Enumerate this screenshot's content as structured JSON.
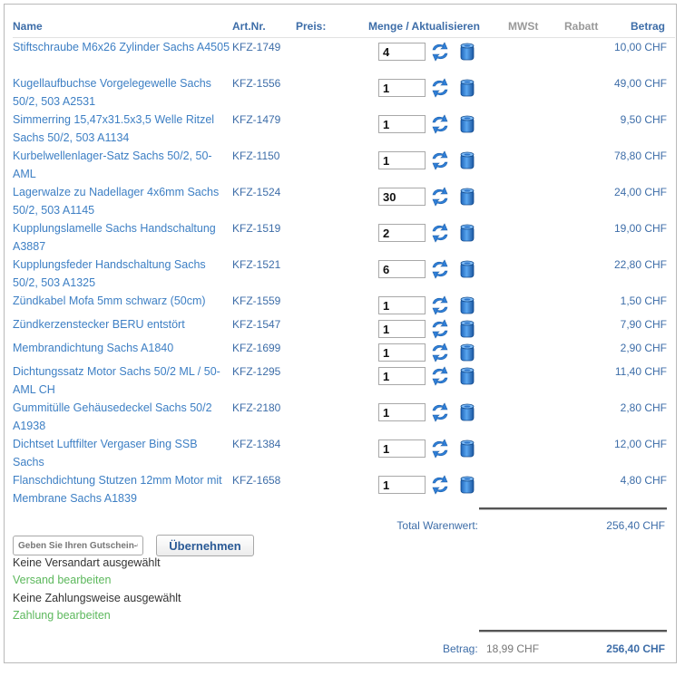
{
  "columns": {
    "name": "Name",
    "artnr": "Art.Nr.",
    "price": "Preis:",
    "quantity": "Menge / Aktualisieren",
    "vat": "MWSt",
    "discount": "Rabatt",
    "amount": "Betrag"
  },
  "items": [
    {
      "name": "Stiftschraube M6x26 Zylinder Sachs A4505",
      "artnr": "KFZ-1749",
      "qty": "4",
      "amount": "10,00 CHF"
    },
    {
      "name": "Kugellaufbuchse Vorgelegewelle Sachs 50/2, 503 A2531",
      "artnr": "KFZ-1556",
      "qty": "1",
      "amount": "49,00 CHF"
    },
    {
      "name": "Simmerring 15,47x31.5x3,5 Welle Ritzel Sachs 50/2, 503 A1134",
      "artnr": "KFZ-1479",
      "qty": "1",
      "amount": "9,50 CHF"
    },
    {
      "name": "Kurbelwellenlager-Satz Sachs 50/2, 50-AML",
      "artnr": "KFZ-1150",
      "qty": "1",
      "amount": "78,80 CHF"
    },
    {
      "name": "Lagerwalze zu Nadellager 4x6mm Sachs 50/2, 503 A1145",
      "artnr": "KFZ-1524",
      "qty": "30",
      "amount": "24,00 CHF"
    },
    {
      "name": "Kupplungslamelle Sachs Handschaltung A3887",
      "artnr": "KFZ-1519",
      "qty": "2",
      "amount": "19,00 CHF"
    },
    {
      "name": "Kupplungsfeder Handschaltung Sachs 50/2, 503 A1325",
      "artnr": "KFZ-1521",
      "qty": "6",
      "amount": "22,80 CHF"
    },
    {
      "name": "Zündkabel Mofa 5mm schwarz (50cm)",
      "artnr": "KFZ-1559",
      "qty": "1",
      "amount": "1,50 CHF"
    },
    {
      "name": "Zündkerzenstecker BERU entstört",
      "artnr": "KFZ-1547",
      "qty": "1",
      "amount": "7,90 CHF"
    },
    {
      "name": "Membrandichtung Sachs A1840",
      "artnr": "KFZ-1699",
      "qty": "1",
      "amount": "2,90 CHF"
    },
    {
      "name": "Dichtungssatz Motor Sachs 50/2 ML / 50-AML CH",
      "artnr": "KFZ-1295",
      "qty": "1",
      "amount": "11,40 CHF"
    },
    {
      "name": "Gummitülle Gehäusedeckel Sachs 50/2 A1938",
      "artnr": "KFZ-2180",
      "qty": "1",
      "amount": "2,80 CHF"
    },
    {
      "name": "Dichtset Luftfilter Vergaser Bing SSB Sachs",
      "artnr": "KFZ-1384",
      "qty": "1",
      "amount": "12,00 CHF"
    },
    {
      "name": "Flanschdichtung Stutzen 12mm Motor mit Membrane Sachs A1839",
      "artnr": "KFZ-1658",
      "qty": "1",
      "amount": "4,80 CHF"
    }
  ],
  "totals": {
    "goods_label": "Total Warenwert:",
    "goods_value": "256,40 CHF",
    "amount_label": "Betrag:",
    "vat_value": "18,99 CHF",
    "amount_value": "256,40 CHF"
  },
  "voucher": {
    "placeholder": "Geben Sie Ihren Gutschein-Code ein",
    "apply_label": "Übernehmen"
  },
  "shipping": {
    "status": "Keine Versandart ausgewählt",
    "edit_link": "Versand bearbeiten"
  },
  "payment": {
    "status": "Keine Zahlungsweise ausgewählt",
    "edit_link": "Zahlung bearbeiten"
  },
  "icons": {
    "update": "refresh-arrows-icon",
    "delete": "trash-can-icon"
  },
  "colors": {
    "link": "#3d7fc4",
    "header": "#3d6da8",
    "green_link": "#5cb85c",
    "icon_blue": "#2f7fd8"
  }
}
